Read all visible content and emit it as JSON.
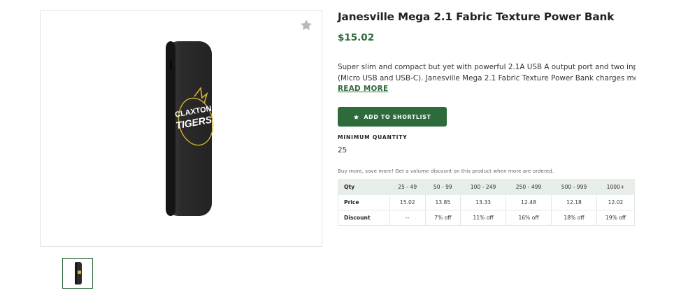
{
  "product": {
    "title": "Janesville Mega 2.1 Fabric Texture Power Bank",
    "price": "$15.02",
    "description_line1": "Super slim and compact but yet with powerful 2.1A USB A output port and two inputs",
    "description_line2": "(Micro USB and USB-C). Janesville Mega 2.1 Fabric Texture Power Bank charges mo...",
    "read_more": "READ MORE",
    "imprint_text_1": "CLAXTON",
    "imprint_text_2": "TIGERS"
  },
  "actions": {
    "shortlist_label": "ADD TO SHORTLIST"
  },
  "minimum_quantity": {
    "label": "MINIMUM QUANTITY",
    "value": "25"
  },
  "volume_discount": {
    "note": "Buy more, save more! Get a volume discount on this product when more are ordered.",
    "rows": [
      {
        "label": "Qty",
        "cells": [
          "25 - 49",
          "50 - 99",
          "100 - 249",
          "250 - 499",
          "500 - 999",
          "1000+"
        ]
      },
      {
        "label": "Price",
        "cells": [
          "15.02",
          "13.85",
          "13.33",
          "12.48",
          "12.18",
          "12.02"
        ]
      },
      {
        "label": "Discount",
        "cells": [
          "--",
          "7% off",
          "11% off",
          "16% off",
          "18% off",
          "19% off"
        ]
      }
    ]
  },
  "icons": {
    "favorite": "star-icon",
    "shortlist": "star-icon"
  },
  "colors": {
    "accent": "#2e6b3b",
    "table_header_bg": "#e7eee8",
    "favorite_star": "#b8b8b8"
  }
}
